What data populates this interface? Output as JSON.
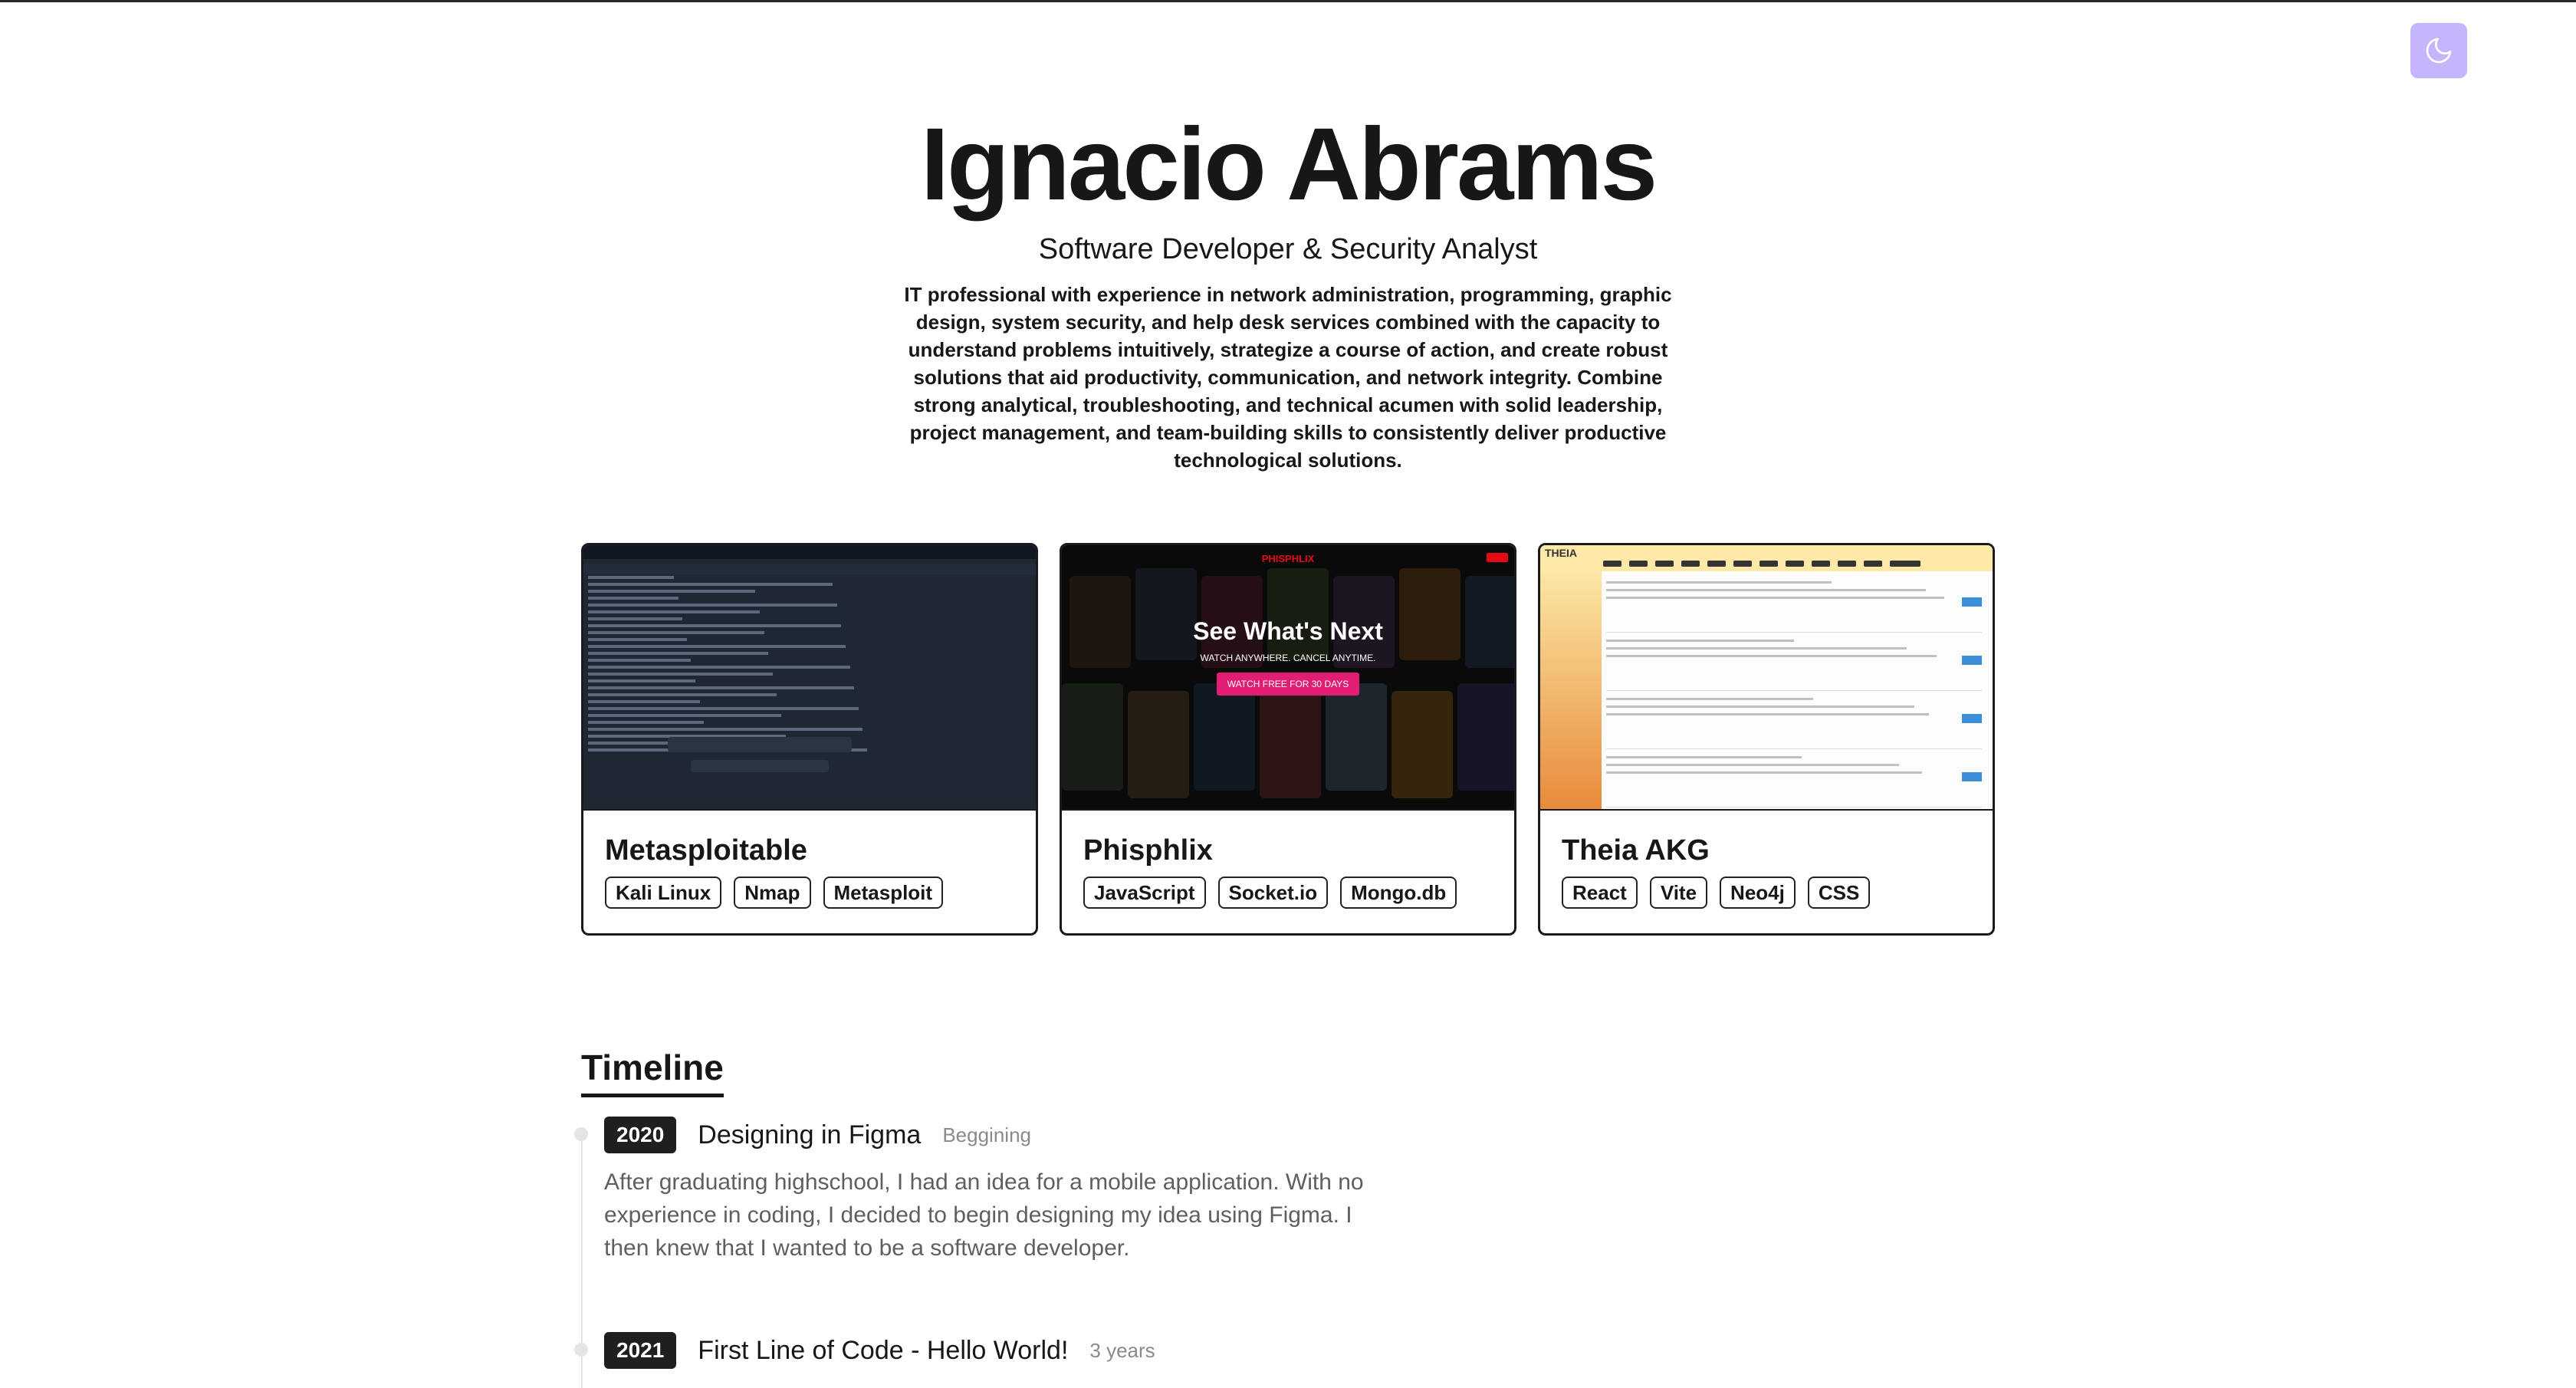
{
  "header": {
    "name": "Ignacio Abrams",
    "role": "Software Developer & Security Analyst",
    "bio": "IT professional with experience in network administration, programming, graphic design, system security, and help desk services combined with the capacity to understand problems intuitively, strategize a course of action, and create robust solutions that aid productivity, communication, and network integrity. Combine strong analytical, troubleshooting, and technical acumen with solid leadership, project management, and team-building skills to consistently deliver productive technological solutions."
  },
  "theme_toggle": {
    "icon": "moon-icon"
  },
  "projects": [
    {
      "title": "Metasploitable",
      "tags": [
        "Kali Linux",
        "Nmap",
        "Metasploit"
      ]
    },
    {
      "title": "Phisphlix",
      "tags": [
        "JavaScript",
        "Socket.io",
        "Mongo.db"
      ],
      "thumb": {
        "logo": "PHISPHLIX",
        "headline": "See What's Next",
        "subline": "WATCH ANYWHERE. CANCEL ANYTIME.",
        "cta": "WATCH FREE FOR 30 DAYS"
      }
    },
    {
      "title": "Theia AKG",
      "tags": [
        "React",
        "Vite",
        "Neo4j",
        "CSS"
      ],
      "thumb": {
        "brand": "THEIA"
      }
    }
  ],
  "timeline": {
    "heading": "Timeline",
    "items": [
      {
        "year": "2020",
        "title": "Designing in Figma",
        "duration": "Beggining",
        "description": "After graduating highschool, I had an idea for a mobile application. With no experience in coding, I decided to begin designing my idea using Figma. I then knew that I wanted to be a software developer."
      },
      {
        "year": "2021",
        "title": "First Line of Code - Hello World!",
        "duration": "3 years"
      }
    ]
  },
  "colors": {
    "accent_toggle": "#c4b5fd",
    "phish_red": "#e50914",
    "phish_cta": "#e11d74"
  }
}
